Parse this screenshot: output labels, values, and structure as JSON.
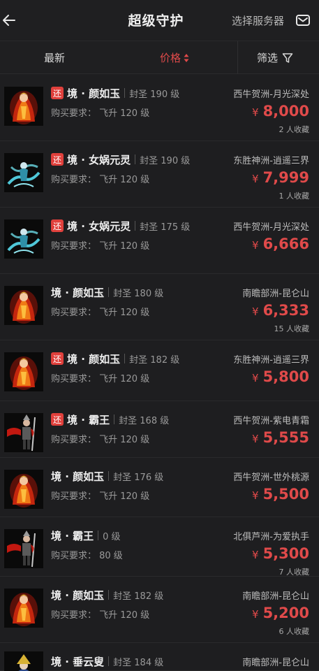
{
  "header": {
    "title": "超级守护",
    "server_label": "选择服务器"
  },
  "filters": {
    "newest": "最新",
    "price": "价格",
    "filter": "筛选"
  },
  "currency": "¥",
  "items": [
    {
      "tag": "还",
      "name": "境 · 颜如玉",
      "level": "封圣 190 级",
      "requirement": "购买要求：  飞升 120 级",
      "server": "西牛贺洲-月光深处",
      "price": "8,000",
      "favorites": "2 人收藏",
      "art": "yanruyu"
    },
    {
      "tag": "还",
      "name": "境 · 女娲元灵",
      "level": "封圣 190 级",
      "requirement": "购买要求：  飞升 120 级",
      "server": "东胜神洲-逍遥三界",
      "price": "7,999",
      "favorites": "1 人收藏",
      "art": "nvwa"
    },
    {
      "tag": "还",
      "name": "境 · 女娲元灵",
      "level": "封圣 175 级",
      "requirement": "购买要求：  飞升 120 级",
      "server": "西牛贺洲-月光深处",
      "price": "6,666",
      "favorites": "",
      "art": "nvwa"
    },
    {
      "tag": "",
      "name": "境 · 颜如玉",
      "level": "封圣 180 级",
      "requirement": "购买要求：  飞升 120 级",
      "server": "南瞻部洲-昆仑山",
      "price": "6,333",
      "favorites": "15 人收藏",
      "art": "yanruyu"
    },
    {
      "tag": "还",
      "name": "境 · 颜如玉",
      "level": "封圣 182 级",
      "requirement": "购买要求：  飞升 120 级",
      "server": "东胜神洲-逍遥三界",
      "price": "5,800",
      "favorites": "",
      "art": "yanruyu"
    },
    {
      "tag": "还",
      "name": "境 · 霸王",
      "level": "封圣 168 级",
      "requirement": "购买要求：  飞升 120 级",
      "server": "西牛贺洲-紫电青霜",
      "price": "5,555",
      "favorites": "",
      "art": "bawang"
    },
    {
      "tag": "",
      "name": "境 · 颜如玉",
      "level": "封圣 176 级",
      "requirement": "购买要求：  飞升 120 级",
      "server": "西牛贺洲-世外桃源",
      "price": "5,500",
      "favorites": "",
      "art": "yanruyu"
    },
    {
      "tag": "",
      "name": "境 · 霸王",
      "level": "0 级",
      "requirement": "购买要求：  80 级",
      "server": "北俱芦洲-为爱执手",
      "price": "5,300",
      "favorites": "7 人收藏",
      "art": "bawang"
    },
    {
      "tag": "",
      "name": "境 · 颜如玉",
      "level": "封圣 182 级",
      "requirement": "购买要求：  飞升 120 级",
      "server": "南瞻部洲-昆仑山",
      "price": "5,200",
      "favorites": "6 人收藏",
      "art": "yanruyu"
    },
    {
      "tag": "",
      "name": "境 · 垂云叟",
      "level": "封圣 184 级",
      "requirement": "",
      "server": "南瞻部洲-昆仑山",
      "price": "",
      "favorites": "",
      "art": "chuiyunsou"
    }
  ]
}
